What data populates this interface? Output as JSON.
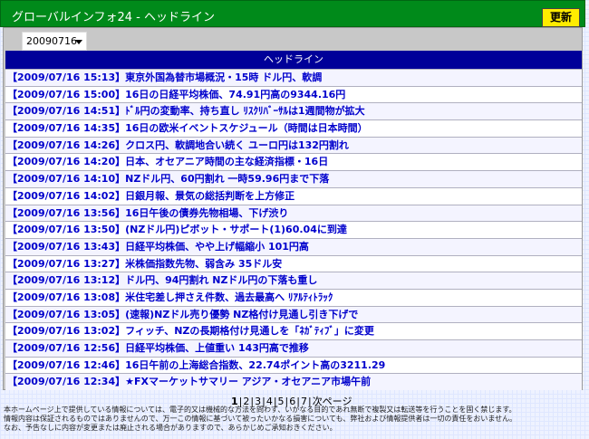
{
  "header": {
    "title": "グローバルインフォ24 - ヘッドライン",
    "refresh_label": "更新"
  },
  "date_select": {
    "value": "20090716"
  },
  "list": {
    "header": "ヘッドライン",
    "items": [
      "【2009/07/16 15:13】東京外国為替市場概況・15時 ドル円、軟調",
      "【2009/07/16 15:00】16日の日経平均株価、74.91円高の9344.16円",
      "【2009/07/16 14:51】ﾄﾞﾙ円の変動率、持ち直し ﾘｽｸﾘﾊﾞｰｻﾙは1週間物が拡大",
      "【2009/07/16 14:35】16日の欧米イベントスケジュール（時間は日本時間）",
      "【2009/07/16 14:26】クロス円、軟調地合い続く ユーロ円は132円割れ",
      "【2009/07/16 14:20】日本、オセアニア時間の主な経済指標・16日",
      "【2009/07/16 14:10】NZドル円、60円割れ 一時59.96円まで下落",
      "【2009/07/16 14:02】日銀月報、景気の総括判断を上方修正",
      "【2009/07/16 13:56】16日午後の債券先物相場、下げ渋り",
      "【2009/07/16 13:50】(NZドル円)ピボット・サポート(1)60.04に到達",
      "【2009/07/16 13:43】日経平均株価、やや上げ幅縮小 101円高",
      "【2009/07/16 13:27】米株価指数先物、弱含み 35ドル安",
      "【2009/07/16 13:12】ドル円、94円割れ NZドル円の下落も重し",
      "【2009/07/16 13:08】米住宅差し押さえ件数、過去最高へ ﾘｱﾙﾃｨﾄﾗｯｸ",
      "【2009/07/16 13:05】(速報)NZドル売り優勢 NZ格付け見通し引き下げで",
      "【2009/07/16 13:02】フィッチ、NZの長期格付け見通しを「ﾈｶﾞﾃｨﾌﾞ」に変更",
      "【2009/07/16 12:56】日経平均株価、上値重い 143円高で推移",
      "【2009/07/16 12:46】16日午前の上海総合指数、22.74ポイント高の3211.29",
      "【2009/07/16 12:34】★FXマーケットサマリー アジア・オセアニア市場午前"
    ]
  },
  "pager": {
    "pages": [
      "1",
      "2",
      "3",
      "4",
      "5",
      "6",
      "7"
    ],
    "next_label": "次ページ"
  },
  "disclaimer": {
    "line1": "本ホームページ上で提供している情報については、電子的又は機械的な方法を問わず、いかなる目的であれ無断で複製又は転送等を行うことを固く禁じます。",
    "line2": "情報内容は保証されるものではありませんので、万一この情報に基づいて被ったいかなる損害についても、弊社および情報提供者は一切の責任をおいません。",
    "line3": "なお、予告なしに内容が変更または廃止される場合がありますので、あらかじめご承知おきください。"
  }
}
